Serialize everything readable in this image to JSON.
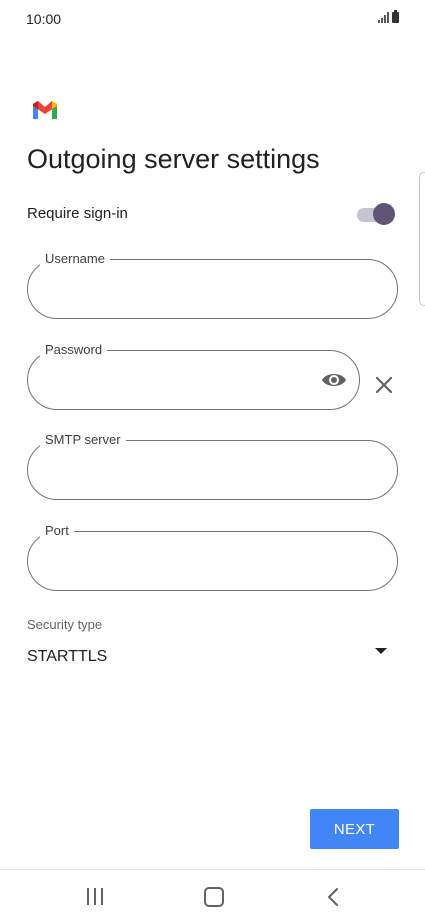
{
  "status_bar": {
    "time": "10:00"
  },
  "app": {
    "logo_icon": "gmail-logo-icon",
    "brand_colors": {
      "red": "#EA4335",
      "blue": "#4285F4",
      "green": "#34A853",
      "yellow": "#FBBC04"
    }
  },
  "header": {
    "title": "Outgoing server settings"
  },
  "require_signin": {
    "label": "Require sign-in",
    "enabled": true,
    "thumb_color": "#5f5675"
  },
  "fields": {
    "username": {
      "label": "Username",
      "value": ""
    },
    "password": {
      "label": "Password",
      "value": "",
      "show_icon": "eye-icon",
      "clear_icon": "close-icon"
    },
    "smtp_server": {
      "label": "SMTP server",
      "value": ""
    },
    "port": {
      "label": "Port",
      "value": ""
    }
  },
  "security": {
    "label": "Security type",
    "selected": "STARTTLS",
    "dropdown_icon": "chevron-down-icon"
  },
  "actions": {
    "next_label": "NEXT",
    "accent_color": "#4285f4"
  },
  "nav_bar": {
    "recent_icon": "recent-apps-icon",
    "home_icon": "home-icon",
    "back_icon": "back-icon"
  }
}
